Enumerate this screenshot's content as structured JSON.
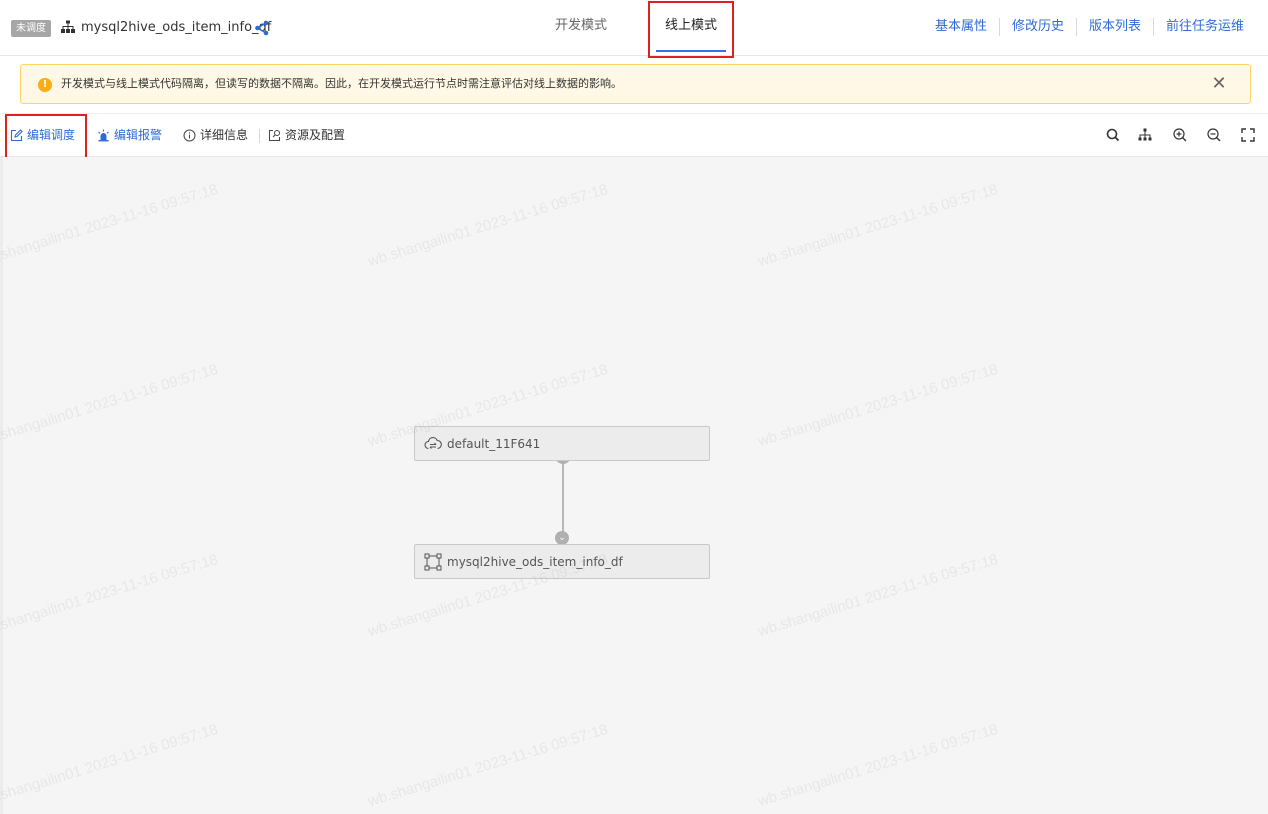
{
  "header": {
    "status_badge": "未调度",
    "task_name": "mysql2hive_ods_item_info_df",
    "modes": {
      "dev": "开发模式",
      "online": "线上模式"
    },
    "links": [
      "基本属性",
      "修改历史",
      "版本列表",
      "前往任务运维"
    ]
  },
  "alert": {
    "icon": "!",
    "text": "开发模式与线上模式代码隔离，但读写的数据不隔离。因此，在开发模式运行节点时需注意评估对线上数据的影响。",
    "close": "✕"
  },
  "toolbar": {
    "edit_schedule": "编辑调度",
    "edit_alarm": "编辑报警",
    "detail_info": "详细信息",
    "resource_config": "资源及配置",
    "right_icons": [
      "search-icon",
      "layout-tree-icon",
      "zoom-in-icon",
      "zoom-out-icon",
      "fullscreen-icon"
    ]
  },
  "graph": {
    "nodes": [
      {
        "label": "default_11F641",
        "icon": "cloud-transfer-icon"
      },
      {
        "label": "mysql2hive_ods_item_info_df",
        "icon": "sync-node-icon"
      }
    ],
    "edge_arrow": "⌄"
  },
  "watermark": "wb.shangailin01 2023-11-16 09:57:18",
  "colors": {
    "accent": "#2f6bd8",
    "highlight_box": "#e02020",
    "alert_bg": "#fff8e6",
    "alert_icon": "#faad14"
  }
}
